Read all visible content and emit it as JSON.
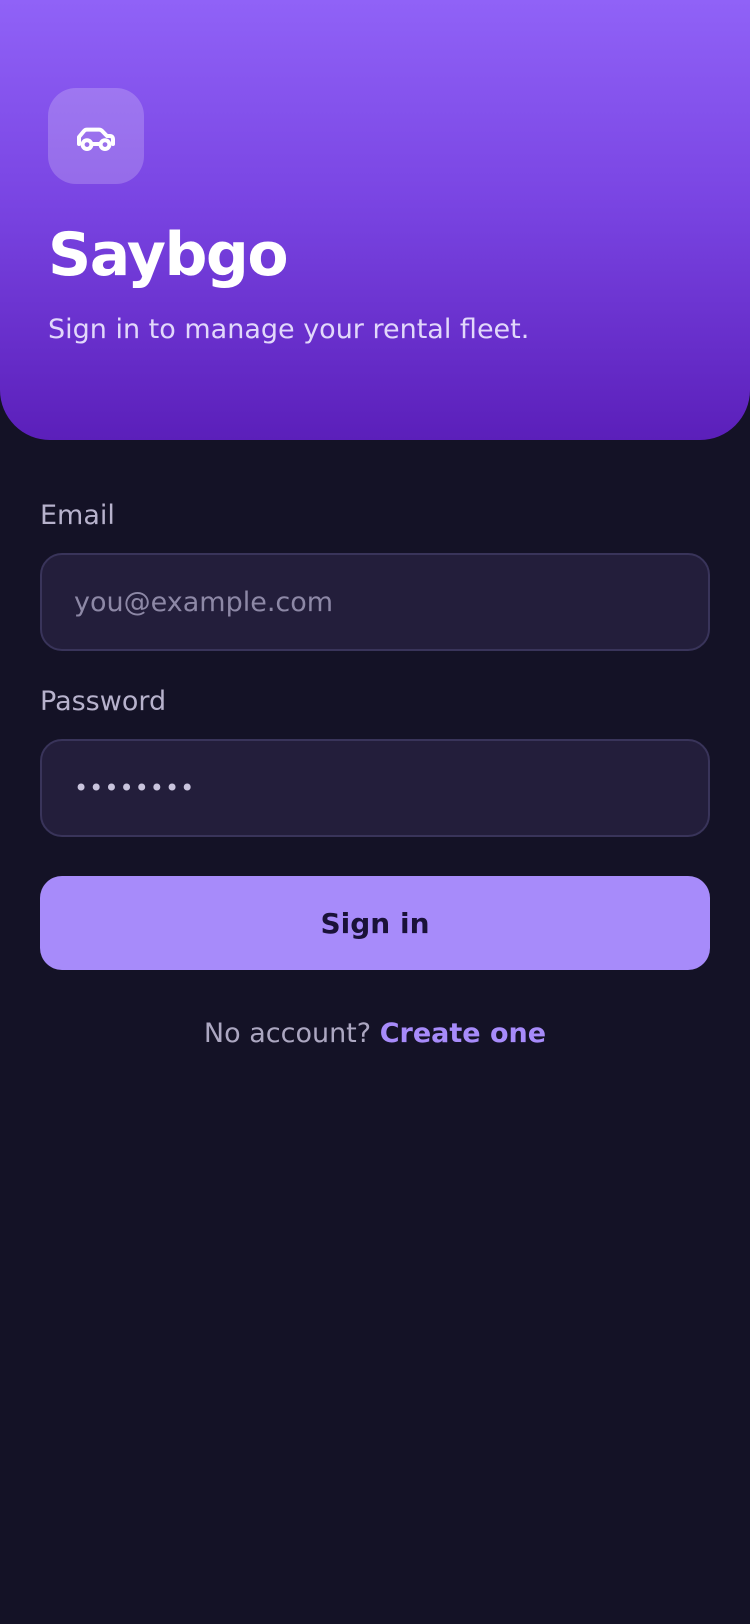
{
  "header": {
    "logo_icon": "car-icon",
    "title": "Saybgo",
    "subtitle": "Sign in to manage your rental fleet."
  },
  "form": {
    "email": {
      "label": "Email",
      "placeholder": "you@example.com",
      "value": ""
    },
    "password": {
      "label": "Password",
      "placeholder": "",
      "value": "••••••••"
    },
    "submit_label": "Sign in"
  },
  "footer": {
    "prompt": "No account?",
    "link_label": "Create one"
  },
  "colors": {
    "accent": "#a78bfa",
    "hero_gradient_top": "#9062f7",
    "hero_gradient_bottom": "#5b1fba",
    "background": "#141226",
    "input_background": "#231e3b"
  }
}
